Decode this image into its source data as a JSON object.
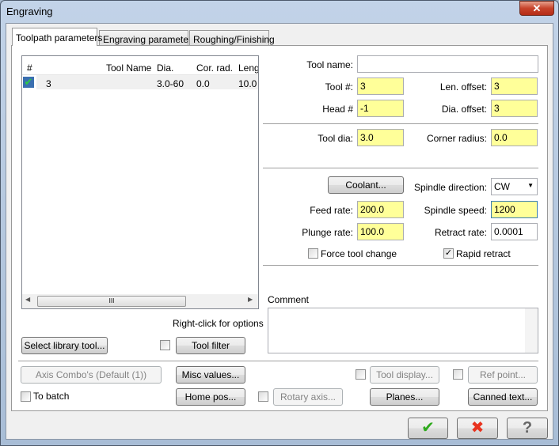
{
  "window": {
    "title": "Engraving",
    "close_glyph": "✕"
  },
  "tabs": [
    {
      "label": "Toolpath parameters"
    },
    {
      "label": "Engraving parameters"
    },
    {
      "label": "Roughing/Finishing"
    }
  ],
  "tool_list": {
    "columns": [
      "#",
      "Tool Name",
      "Dia.",
      "Cor. rad.",
      "Leng"
    ],
    "rows": [
      {
        "num": "3",
        "name": "",
        "dia": "3.0-60",
        "cor_rad": "0.0",
        "length": "10.0"
      }
    ],
    "hint": "Right-click for options",
    "scroll_thumb": "III"
  },
  "fields": {
    "tool_name": {
      "label": "Tool name:",
      "value": ""
    },
    "tool_num": {
      "label": "Tool #:",
      "value": "3"
    },
    "len_offset": {
      "label": "Len. offset:",
      "value": "3"
    },
    "head_num": {
      "label": "Head #",
      "value": "-1"
    },
    "dia_offset": {
      "label": "Dia. offset:",
      "value": "3"
    },
    "tool_dia": {
      "label": "Tool dia:",
      "value": "3.0"
    },
    "corner_radius": {
      "label": "Corner radius:",
      "value": "0.0"
    },
    "spindle_direction": {
      "label": "Spindle direction:",
      "value": "CW"
    },
    "feed_rate": {
      "label": "Feed rate:",
      "value": "200.0"
    },
    "spindle_speed": {
      "label": "Spindle speed:",
      "value": "1200"
    },
    "plunge_rate": {
      "label": "Plunge rate:",
      "value": "100.0"
    },
    "retract_rate": {
      "label": "Retract rate:",
      "value": "0.0001"
    },
    "comment": {
      "label": "Comment",
      "value": ""
    }
  },
  "checks": {
    "force_tool_change": {
      "label": "Force tool change",
      "checked": false
    },
    "rapid_retract": {
      "label": "Rapid retract",
      "checked": true
    },
    "to_batch": {
      "label": "To batch",
      "checked": false
    }
  },
  "buttons": {
    "coolant": "Coolant...",
    "select_library_tool": "Select library tool...",
    "tool_filter": "Tool filter",
    "axis_combo": "Axis Combo's (Default (1))",
    "misc_values": "Misc values...",
    "tool_display": "Tool display...",
    "ref_point": "Ref point...",
    "home_pos": "Home pos...",
    "rotary_axis": "Rotary axis...",
    "planes": "Planes...",
    "canned_text": "Canned text..."
  },
  "dialog_buttons": {
    "ok": "✔",
    "cancel": "✖",
    "help": "?"
  },
  "colors": {
    "highlight_field": "#ffff99",
    "ok": "#2faa1e",
    "cancel": "#e8321e"
  }
}
